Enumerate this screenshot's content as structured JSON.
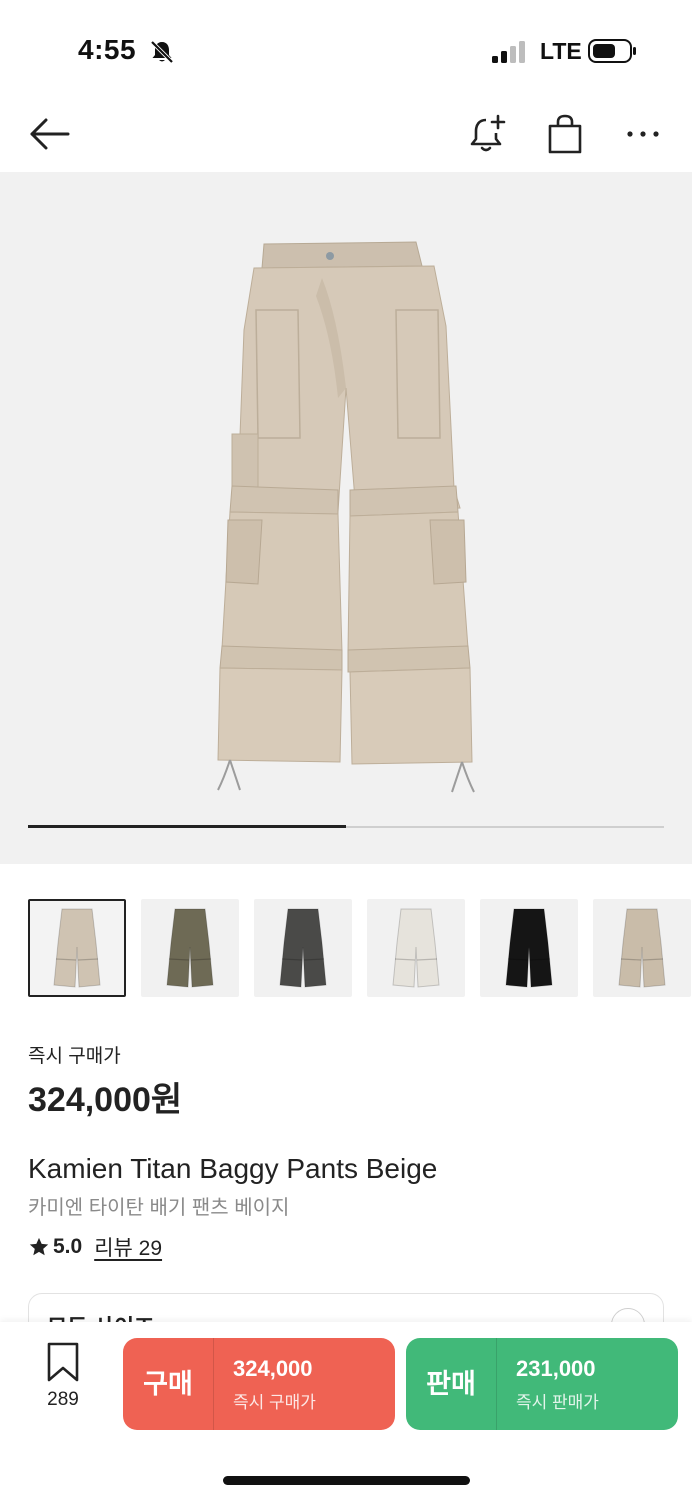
{
  "status_bar": {
    "time": "4:55",
    "network": "LTE"
  },
  "nav": {
    "back_icon": "back-arrow-icon",
    "alert_icon": "bell-plus-icon",
    "cart_icon": "shopping-bag-icon",
    "more_icon": "more-horizontal-icon"
  },
  "hero": {
    "image": "beige cargo pants",
    "carousel_progress": 0.5
  },
  "thumbnails": [
    {
      "color": "#cfc3b2",
      "selected": true
    },
    {
      "color": "#6e6a55",
      "selected": false
    },
    {
      "color": "#4a4a48",
      "selected": false
    },
    {
      "color": "#e6e3dc",
      "selected": false
    },
    {
      "color": "#151515",
      "selected": false
    },
    {
      "color": "#c9bca9",
      "selected": false
    }
  ],
  "price": {
    "label": "즉시 구매가",
    "value": "324,000원"
  },
  "product": {
    "title_en": "Kamien Titan Baggy Pants Beige",
    "title_ko": "카미엔 타이탄 배기 팬츠 베이지",
    "rating": "5.0",
    "review_link": "리뷰 29"
  },
  "size_selector": {
    "label": "모든 사이즈"
  },
  "bottom_bar": {
    "wish_count": "289",
    "buy": {
      "label": "구매",
      "price": "324,000",
      "sub": "즉시 구매가",
      "color": "#ef6253"
    },
    "sell": {
      "label": "판매",
      "price": "231,000",
      "sub": "즉시 판매가",
      "color": "#41b979"
    }
  }
}
